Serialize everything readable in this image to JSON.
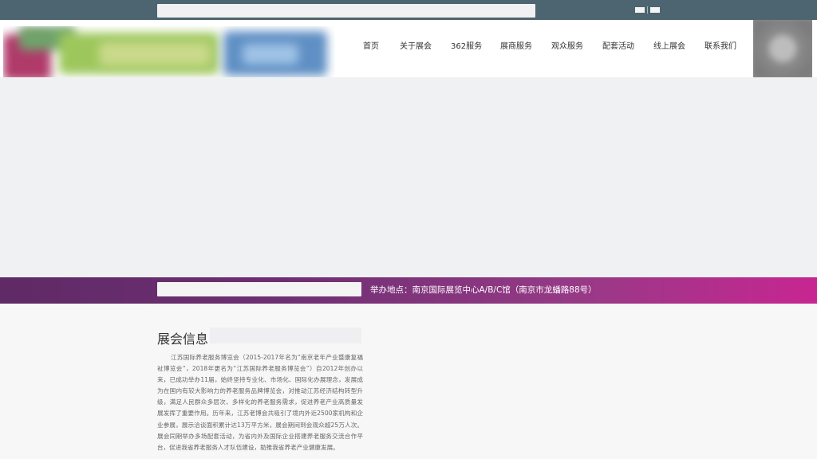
{
  "topbar": {
    "lang_items": [
      "",
      ""
    ]
  },
  "header": {
    "nav": [
      {
        "label": "首页"
      },
      {
        "label": "关于展会"
      },
      {
        "label": "362服务"
      },
      {
        "label": "展商服务"
      },
      {
        "label": "观众服务"
      },
      {
        "label": "配套活动"
      },
      {
        "label": "线上展会"
      },
      {
        "label": "联系我们"
      }
    ]
  },
  "infobar": {
    "venue": "举办地点：南京国际展览中心A/B/C馆（南京市龙蟠路88号）"
  },
  "about": {
    "title": "展会信息",
    "text": "江苏国际养老服务博览会（2015-2017年名为“南京老年产业暨康复福祉博览会”，2018年更名为“江苏国际养老服务博览会”）自2012年创办以来，已成功举办11届，始终坚持专业化、市场化、国际化办展理念，发展成为在国内有较大影响力的养老服务品牌博览会，对推动江苏经济结构转型升级，满足人民群众多层次、多样化的养老服务需求，促进养老产业高质量发展发挥了重要作用。历年来，江苏老博会共吸引了境内外近2500家机构和企业参展，展示洽谈面积累计达13万平方米，展会期间到会观众超25万人次。展会同期举办多场配套活动，为省内外及国际企业搭建养老服务交流合作平台，促进我省养老服务人才队伍建设，助推我省养老产业健康发展。"
  },
  "colors": {
    "topbar": "#4d6571",
    "infobar_start": "#5f2a66",
    "infobar_end": "#c72691"
  }
}
